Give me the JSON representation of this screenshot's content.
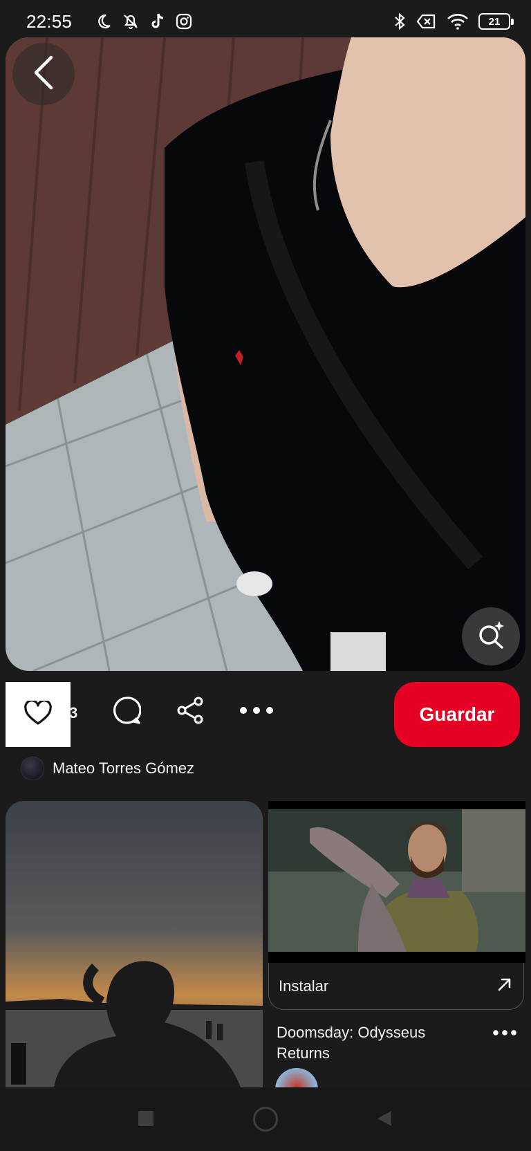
{
  "status_bar": {
    "time": "22:55",
    "left_icons": [
      "moon-icon",
      "bell-off-icon",
      "tiktok-icon",
      "instagram-icon"
    ],
    "right_icons": [
      "bluetooth-icon",
      "sim-off-icon",
      "wifi-icon"
    ],
    "battery": "21"
  },
  "pin": {
    "image": "photo-person-black-polo",
    "back_icon": "chevron-left-icon",
    "visual_search_icon": "lens-sparkle-icon"
  },
  "actions": {
    "like_icon": "heart-icon",
    "like_count": "3",
    "comment_icon": "comment-icon",
    "share_icon": "share-icon",
    "more_icon": "more-horizontal-icon",
    "save_label": "Guardar"
  },
  "author": {
    "name": "Mateo Torres Gómez"
  },
  "feed": {
    "left_pin_image": "photo-silhouette-sunset",
    "ad": {
      "media": "game-trailer-frame",
      "install_label": "Instalar",
      "install_icon": "arrow-up-right-icon",
      "title": "Doomsday: Odysseus Returns",
      "more_icon": "more-horizontal-icon"
    }
  },
  "colors": {
    "background": "#1b1b1b",
    "accent": "#e60023"
  }
}
